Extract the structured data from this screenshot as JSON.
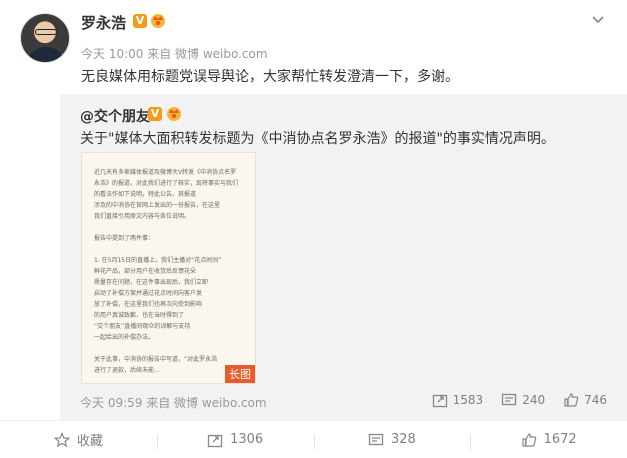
{
  "post": {
    "author": "罗永浩",
    "verified_badge": "V",
    "meta": "今天 10:00 来自 微博 weibo.com",
    "text": "无良媒体用标题党误导舆论，大家帮忙转发澄清一下，多谢。"
  },
  "repost": {
    "author": "@交个朋友",
    "verified_badge": "V",
    "text": "关于\"媒体大面积转发标题为《中消协点名罗永浩》的报道\"的事实情况声明。",
    "long_image_tag": "长图",
    "long_image_lines": [
      "近几天有多家媒体报道及微博大V转发《中消协点名罗",
      "永浩》的报道，对此我们进行了核实，现将事实与我们",
      "的看法作如下说明，特此公告。其报道",
      "涉及的中消协在官网上发出的一份报告，在这里",
      "我们直接引用原文内容与各位说明。",
      "",
      "报告中提到了两件事：",
      "",
      "1. 在5月15日的直播上，我们主播对“花点时间”",
      "鲜花产品，部分用户在收货后反馈花朵",
      "质量存在问题，在这件事出现后，我们立即",
      "启动了补偿方案并通过花点时间向客户发",
      "放了补偿，在这里我们也再次向受到影响",
      "的用户真诚致歉，也在当时得到了",
      "“交个朋友”直播间观众的谅解与支持",
      "一起给出的补偿办法。",
      "",
      "关于此事，中消协的报告中写道，“对此罗永浩",
      "进行了退款，后续未能..."
    ],
    "meta": "今天 09:59 来自 微博 weibo.com",
    "reposts": "1583",
    "comments": "240",
    "likes": "746"
  },
  "actions": {
    "favorite": "收藏",
    "repost": "1306",
    "comment": "328",
    "like": "1672"
  },
  "colors": {
    "badge": "#f79a16",
    "long_tag": "#e85b2b",
    "repost_bg": "#f2f2f5"
  }
}
